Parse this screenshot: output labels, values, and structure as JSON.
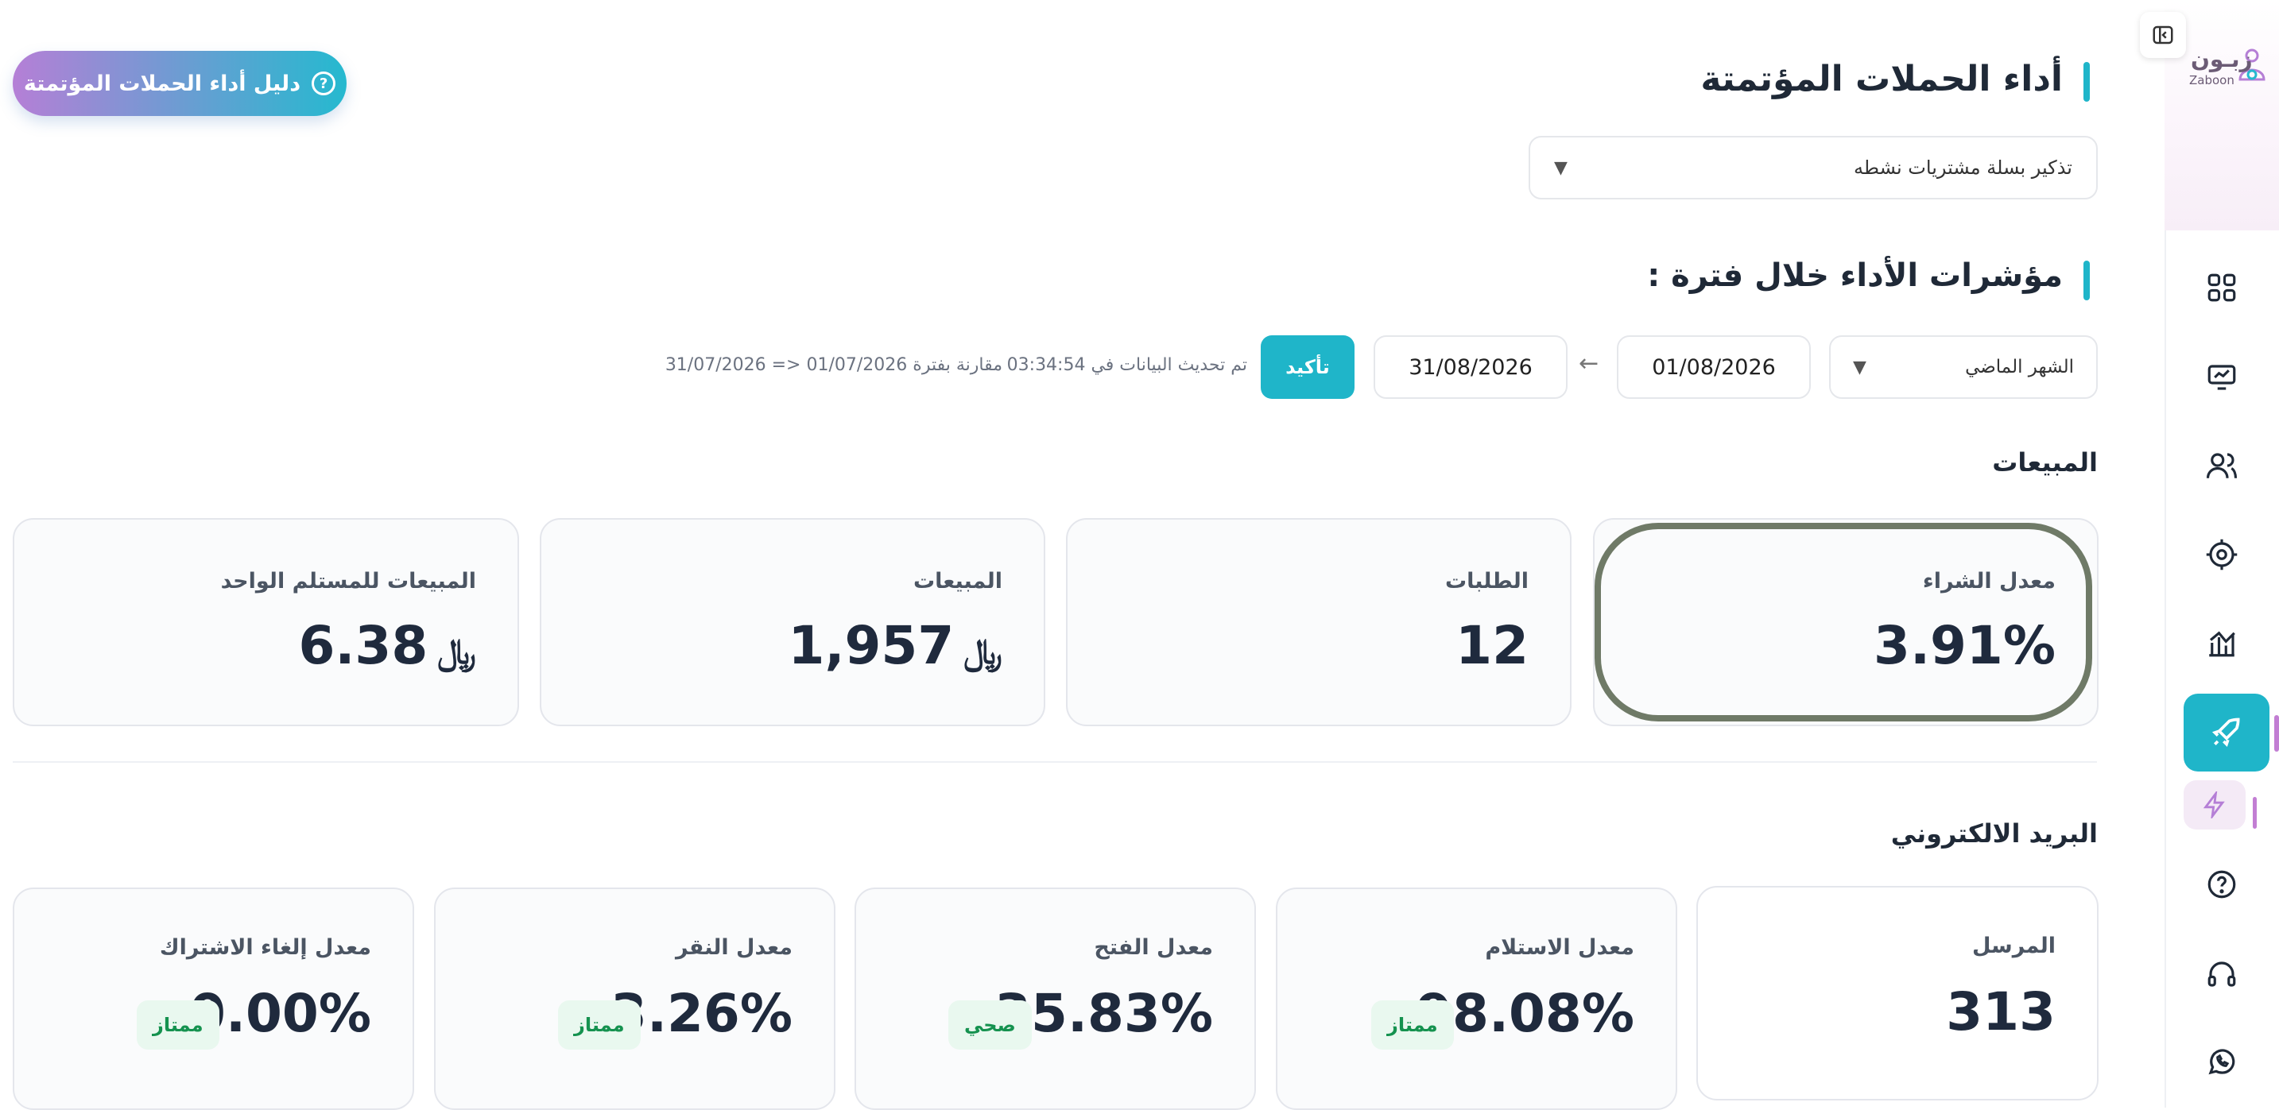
{
  "brand": {
    "name": "زبـون",
    "sub": "Zaboon"
  },
  "guide_button": "دليل أداء الحملات المؤتمتة",
  "page_title": "أداء الحملات المؤتمتة",
  "campaign_select": "تذكير بسلة مشتريات نشطه",
  "kpi_title": "مؤشرات الأداء خلال فترة :",
  "filters": {
    "period": "الشهر الماضي",
    "date_from": "01/08/2026",
    "date_to": "31/08/2026",
    "confirm": "تأكيد",
    "updated_label": "تم تحديث البيانات في 03:34:54",
    "compare_label": "مقارنة بفترة 01/07/2026 <= 31/07/2026"
  },
  "sales": {
    "title": "المبيعات",
    "cards": [
      {
        "label": "معدل الشراء",
        "value": "3.91%"
      },
      {
        "label": "الطلبات",
        "value": "12"
      },
      {
        "label": "المبيعات",
        "value": "1,957",
        "currency": "﷼"
      },
      {
        "label": "المبيعات للمستلم الواحد",
        "value": "6.38",
        "currency": "﷼"
      }
    ]
  },
  "email": {
    "title": "البريد الالكتروني",
    "cards": [
      {
        "label": "المرسل",
        "value": "313"
      },
      {
        "label": "معدل الاستلام",
        "value": "98.08%",
        "badge": "ممتاز"
      },
      {
        "label": "معدل الفتح",
        "value": "35.83%",
        "badge": "صحي"
      },
      {
        "label": "معدل النقر",
        "value": "3.26%",
        "badge": "ممتاز"
      },
      {
        "label": "معدل إلغاء الاشتراك",
        "value": "0.00%",
        "badge": "ممتاز"
      }
    ]
  },
  "colors": {
    "accent": "#1fb5c9",
    "purple": "#b57fd6",
    "good": "#15924f"
  }
}
